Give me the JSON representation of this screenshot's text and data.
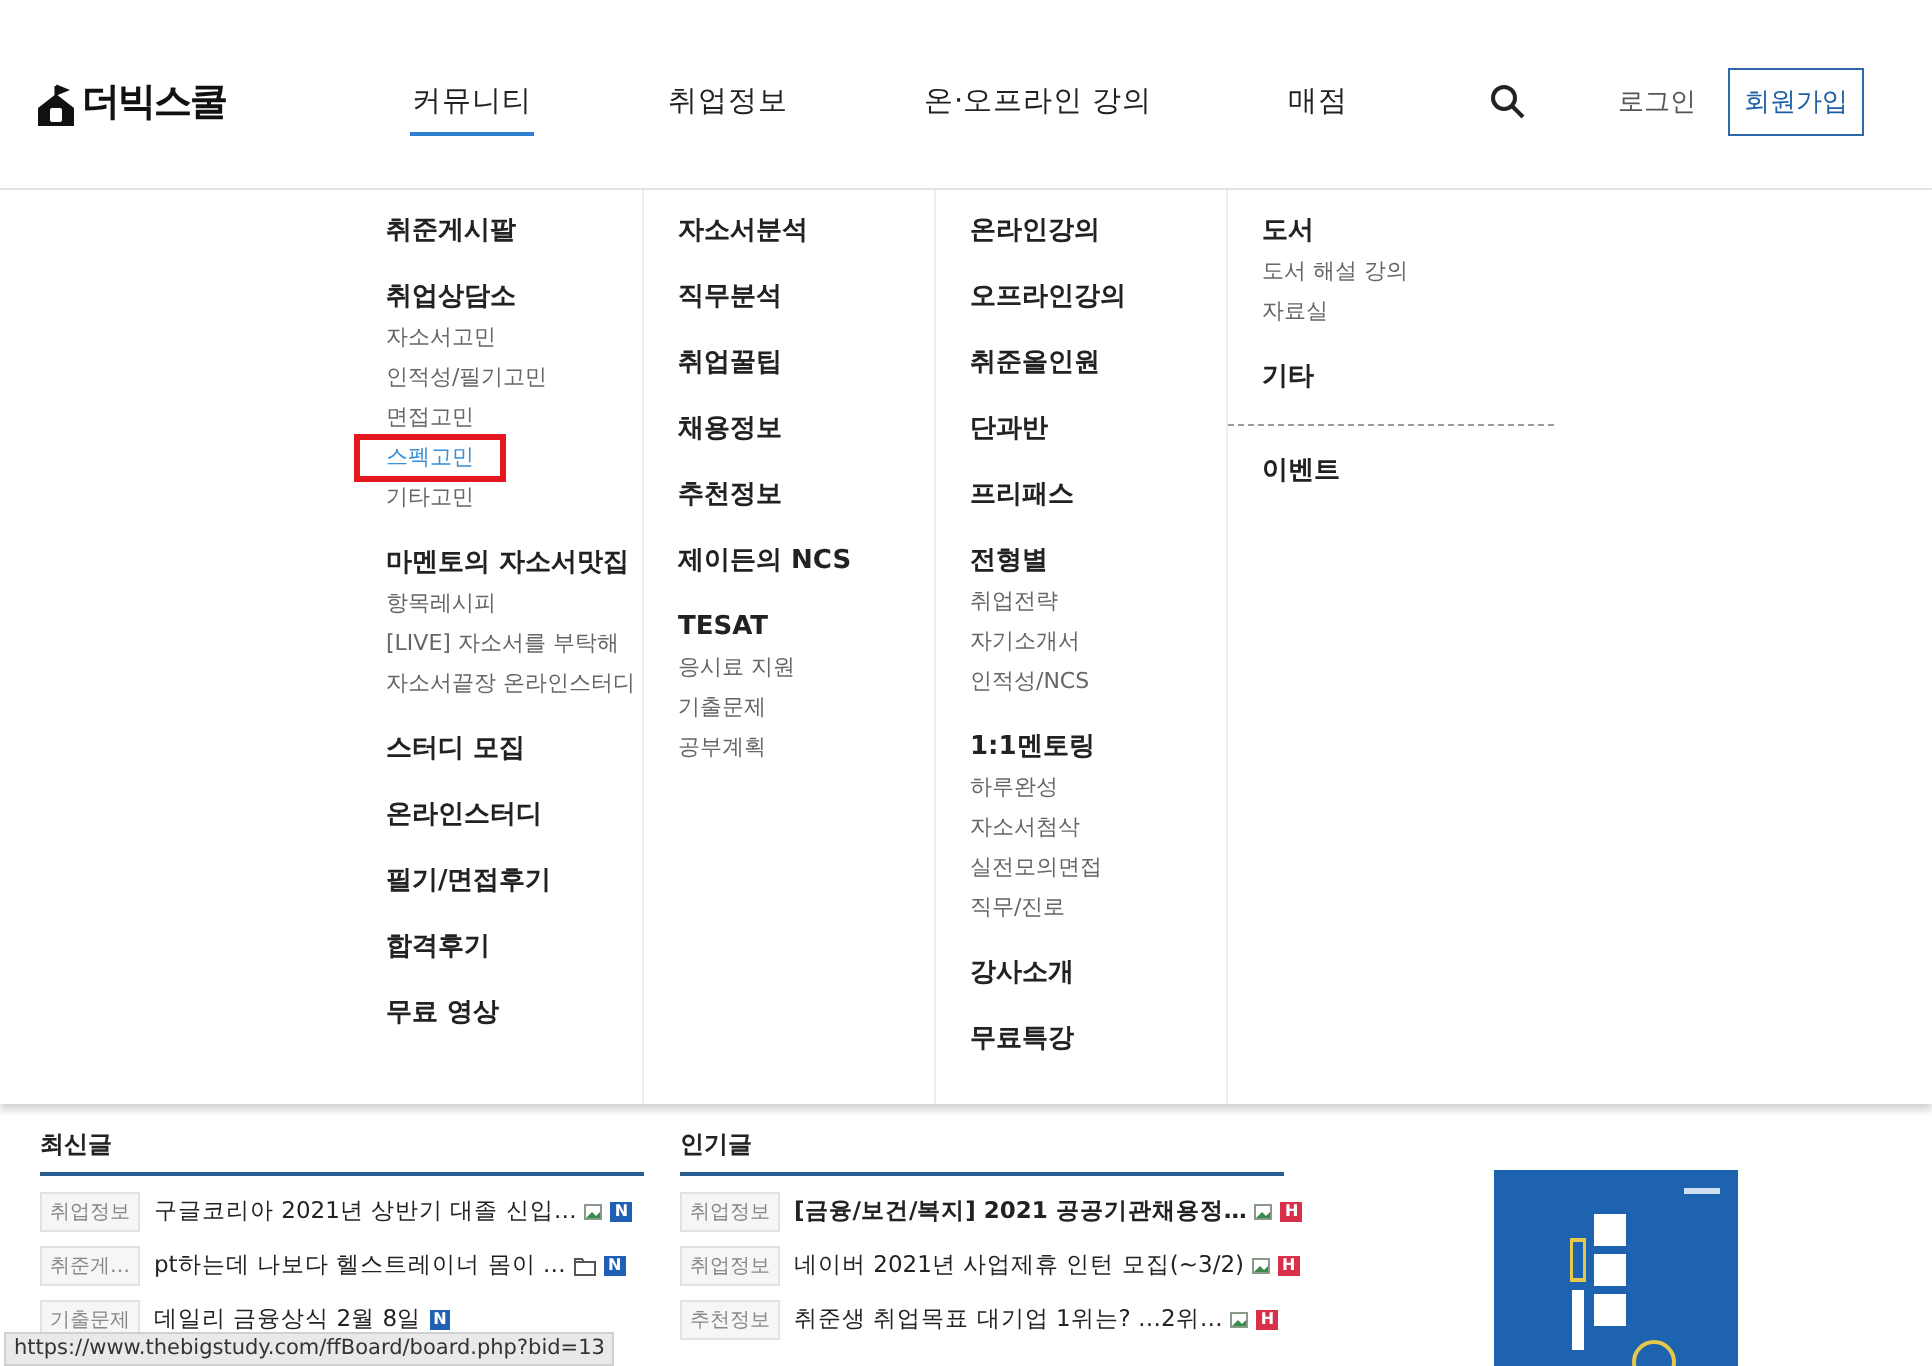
{
  "logo": "더빅스쿨",
  "nav": [
    {
      "label": "커뮤니티",
      "selected": true
    },
    {
      "label": "취업정보",
      "selected": false
    },
    {
      "label": "온·오프라인 강의",
      "selected": false
    },
    {
      "label": "매점",
      "selected": false
    }
  ],
  "login": "로그인",
  "signup": "회원가입",
  "mega_menu": [
    [
      {
        "label": "취준게시팔"
      },
      {
        "label": "취업상담소",
        "children": [
          {
            "label": "자소서고민",
            "selected": false
          },
          {
            "label": "인적성/필기고민",
            "selected": false
          },
          {
            "label": "면접고민",
            "selected": false
          },
          {
            "label": "스펙고민",
            "selected": true
          },
          {
            "label": "기타고민",
            "selected": false
          }
        ]
      },
      {
        "label": "마멘토의 자소서맛집",
        "children": [
          {
            "label": "항목레시피",
            "selected": false
          },
          {
            "label": "[LIVE] 자소서를 부탁해",
            "selected": false
          },
          {
            "label": "자소서끝장 온라인스터디",
            "selected": false
          }
        ]
      },
      {
        "label": "스터디 모집"
      },
      {
        "label": "온라인스터디"
      },
      {
        "label": "필기/면접후기"
      },
      {
        "label": "합격후기"
      },
      {
        "label": "무료 영상"
      }
    ],
    [
      {
        "label": "자소서분석"
      },
      {
        "label": "직무분석"
      },
      {
        "label": "취업꿀팁"
      },
      {
        "label": "채용정보"
      },
      {
        "label": "추천정보"
      },
      {
        "label": "제이든의 NCS"
      },
      {
        "label": "TESAT",
        "children": [
          {
            "label": "응시료 지원",
            "selected": false
          },
          {
            "label": "기출문제",
            "selected": false
          },
          {
            "label": "공부계획",
            "selected": false
          }
        ]
      }
    ],
    [
      {
        "label": "온라인강의"
      },
      {
        "label": "오프라인강의"
      },
      {
        "label": "취준올인원"
      },
      {
        "label": "단과반"
      },
      {
        "label": "프리패스"
      },
      {
        "label": "전형별",
        "children": [
          {
            "label": "취업전략",
            "selected": false
          },
          {
            "label": "자기소개서",
            "selected": false
          },
          {
            "label": "인적성/NCS",
            "selected": false
          }
        ]
      },
      {
        "label": "1:1멘토링",
        "children": [
          {
            "label": "하루완성",
            "selected": false
          },
          {
            "label": "자소서첨삭",
            "selected": false
          },
          {
            "label": "실전모의면접",
            "selected": false
          },
          {
            "label": "직무/진로",
            "selected": false
          }
        ]
      },
      {
        "label": "강사소개"
      },
      {
        "label": "무료특강"
      }
    ],
    [
      {
        "label": "도서",
        "divider": false,
        "children": [
          {
            "label": "도서 해설 강의",
            "selected": false
          },
          {
            "label": "자료실",
            "selected": false
          }
        ]
      },
      {
        "label": "기타",
        "divider": false
      },
      {
        "label": "이벤트",
        "divider": true
      }
    ]
  ],
  "boards": [
    {
      "title": "최신글",
      "posts": [
        {
          "tag": "취업정보",
          "title": "구글코리아 2021년 상반기 대졸 신입…",
          "bold": false,
          "image": true,
          "file": false,
          "badge": {
            "text": "N",
            "color": "#1f5fb4"
          }
        },
        {
          "tag": "취준게…",
          "title": "pt하는데 나보다 헬스트레이너 몸이 …",
          "bold": false,
          "image": false,
          "file": true,
          "badge": {
            "text": "N",
            "color": "#1f5fb4"
          }
        },
        {
          "tag": "기출문제",
          "title": "데일리 금융상식 2월 8일",
          "bold": false,
          "image": false,
          "file": false,
          "badge": {
            "text": "N",
            "color": "#1f5fb4"
          }
        }
      ]
    },
    {
      "title": "인기글",
      "posts": [
        {
          "tag": "취업정보",
          "title": "[금융/보건/복지] 2021 공공기관채용정…",
          "bold": true,
          "image": true,
          "file": false,
          "badge": {
            "text": "H",
            "color": "#d9304a"
          }
        },
        {
          "tag": "취업정보",
          "title": "네이버 2021년 사업제휴 인턴 모집(~3/2)",
          "bold": false,
          "image": true,
          "file": false,
          "badge": {
            "text": "H",
            "color": "#d9304a"
          }
        },
        {
          "tag": "추천정보",
          "title": "취준생 취업목표 대기업 1위는? …2위…",
          "bold": false,
          "image": true,
          "file": false,
          "badge": {
            "text": "H",
            "color": "#d9304a"
          }
        }
      ]
    }
  ],
  "book_cover": {
    "kind": "picture"
  },
  "status_url": "https://www.thebigstudy.com/ffBoard/board.php?bid=13"
}
